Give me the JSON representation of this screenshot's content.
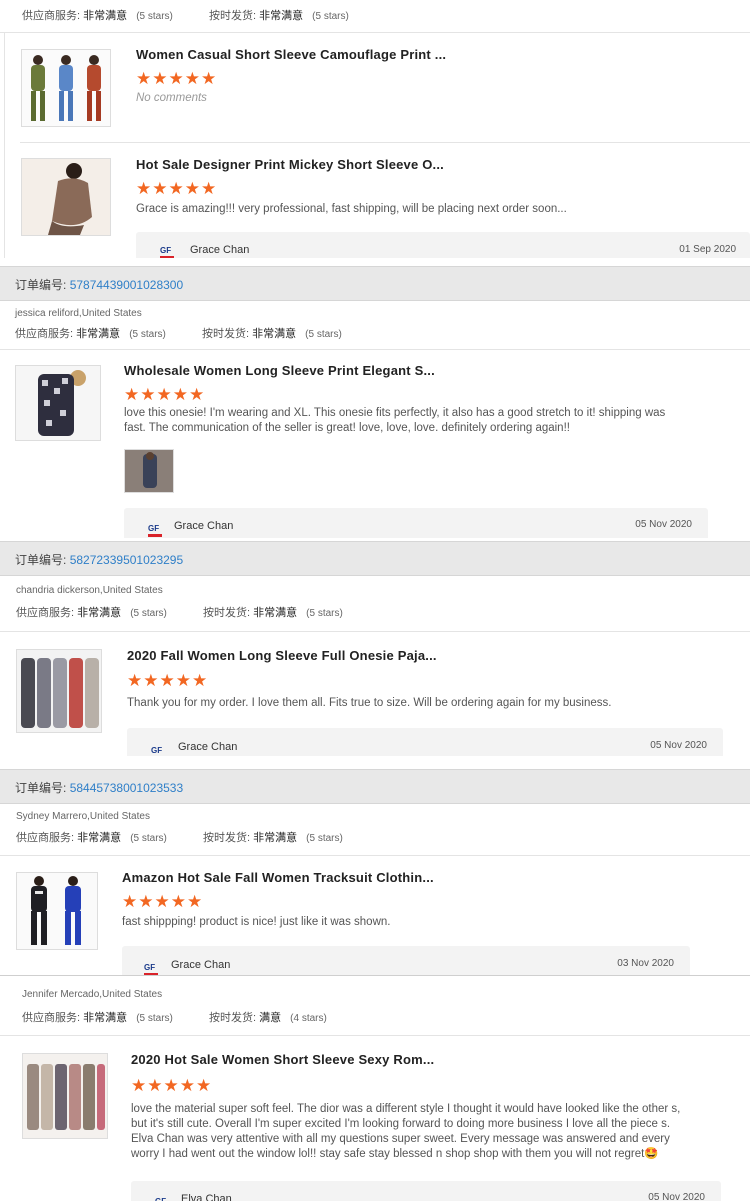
{
  "labels": {
    "supplier_service": "供应商服务:",
    "on_time_shipping": "按时发货:",
    "order_number": "订单编号:"
  },
  "colors": {
    "star": "#f26722",
    "order_link": "#2f7fc8",
    "order_bar": "#e8e8e8",
    "reply_bg": "#f3f3f3"
  },
  "icons": {
    "star": "star-icon",
    "seller_logo": "seller-logo-icon"
  },
  "segments": [
    {
      "ratings": {
        "supplier": "非常满意",
        "supplier_count": "(5 stars)",
        "shipping": "非常满意",
        "shipping_count": "(5 stars)"
      },
      "products": [
        {
          "title": "Women Casual Short Sleeve Camouflage Print ...",
          "stars": "★★★★★",
          "rating": 5,
          "comment": "No comments"
        },
        {
          "title": "Hot Sale Designer Print Mickey Short Sleeve O...",
          "stars": "★★★★★",
          "rating": 5,
          "comment": "Grace is amazing!!! very professional, fast shipping, will be placing next order soon..."
        }
      ],
      "reply": {
        "name": "Grace Chan",
        "date": "01 Sep 2020"
      }
    },
    {
      "order": "57874439001028300",
      "reviewer": "jessica reliford,United States",
      "ratings": {
        "supplier": "非常满意",
        "supplier_count": "(5 stars)",
        "shipping": "非常满意",
        "shipping_count": "(5 stars)"
      },
      "product": {
        "title": "Wholesale Women Long Sleeve Print Elegant S...",
        "stars": "★★★★★",
        "rating": 5,
        "comment": "love this onesie! I'm wearing and XL. This onesie fits perfectly, it also has a good stretch to it! shipping was fast. The communication of the seller is great! love, love, love. definitely ordering again!!"
      },
      "reply": {
        "name": "Grace Chan",
        "date": "05 Nov 2020"
      }
    },
    {
      "order": "58272339501023295",
      "reviewer": "chandria dickerson,United States",
      "ratings": {
        "supplier": "非常满意",
        "supplier_count": "(5 stars)",
        "shipping": "非常满意",
        "shipping_count": "(5 stars)"
      },
      "product": {
        "title": "2020 Fall Women Long Sleeve Full Onesie Paja...",
        "stars": "★★★★★",
        "rating": 5,
        "comment": "Thank you for my order. I love them all. Fits true to size. Will be ordering again for my business."
      },
      "reply": {
        "name": "Grace Chan",
        "date": "05 Nov 2020"
      }
    },
    {
      "order": "58445738001023533",
      "reviewer": "Sydney Marrero,United States",
      "ratings": {
        "supplier": "非常满意",
        "supplier_count": "(5 stars)",
        "shipping": "非常满意",
        "shipping_count": "(5 stars)"
      },
      "product": {
        "title": "Amazon Hot Sale Fall Women Tracksuit Clothin...",
        "stars": "★★★★★",
        "rating": 5,
        "comment": "fast shippping! product is nice! just like it was shown."
      },
      "reply": {
        "name": "Grace Chan",
        "date": "03 Nov 2020"
      }
    },
    {
      "reviewer": "Jennifer Mercado,United States",
      "ratings": {
        "supplier": "非常满意",
        "supplier_count": "(5 stars)",
        "shipping": "满意",
        "shipping_count": "(4 stars)"
      },
      "product": {
        "title": "2020 Hot Sale Women Short Sleeve Sexy Rom...",
        "stars": "★★★★★",
        "rating": 5,
        "comment": "love the material super soft feel. The dior was a different style I thought it would have looked like the other s, but it's still cute. Overall I'm super excited I'm looking forward to doing more business I love all the piece s. Elva Chan was very attentive with all my questions super sweet. Every message was answered and every worry I had went out the window lol!! stay safe stay blessed n shop shop with them you will not regret🤩"
      },
      "reply": {
        "name": "Elva Chan",
        "date": "05 Nov 2020"
      }
    }
  ]
}
